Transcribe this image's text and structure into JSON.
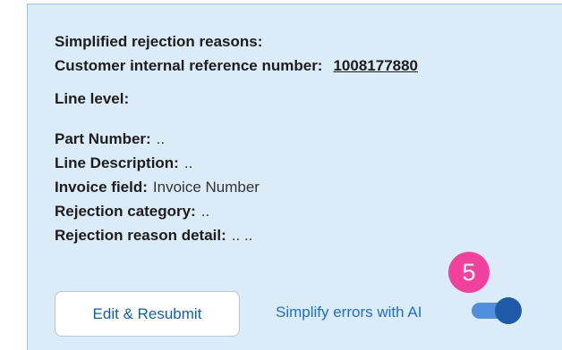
{
  "summary": {
    "simplified_title": "Simplified rejection reasons:",
    "reference_label": "Customer internal reference number:",
    "reference_value": "1008177880",
    "line_level_title": "Line level:"
  },
  "fields": [
    {
      "label": "Part Number:",
      "value": ".."
    },
    {
      "label": "Line Description:",
      "value": ".."
    },
    {
      "label": "Invoice field:",
      "value": "Invoice Number"
    },
    {
      "label": "Rejection category:",
      "value": ".."
    },
    {
      "label": "Rejection reason detail:",
      "value": ".. .."
    }
  ],
  "actions": {
    "edit_resubmit_label": "Edit & Resubmit",
    "simplify_ai_label": "Simplify errors with AI",
    "simplify_ai_enabled": true
  },
  "annotation": {
    "step_number": "5",
    "color": "#f2419c"
  },
  "colors": {
    "panel_bg": "#dcebf8",
    "accent": "#1f6fc7",
    "toggle_on": "#1f5aa8"
  }
}
